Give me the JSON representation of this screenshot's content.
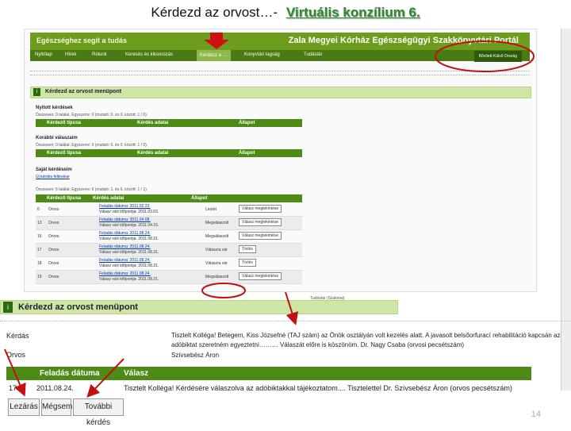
{
  "slide": {
    "title_main": "Kérdezd az orvost…-",
    "title_sub": "Virtuális konzílium 6.",
    "page_number": "14"
  },
  "portal": {
    "left_title": "Egészséghez segít a tudás",
    "right_title": "Zala Megyei Kórház Egészségügyi Szakkönyvtári Portál",
    "menu": [
      "Nyitólap",
      "Hírek",
      "Rólunk",
      "Keresés és kiksorozás",
      "Kérdezz a …",
      "Konyvtári tagság",
      "Tudástár"
    ],
    "menu_dropdown": "Bővített Külső Ország",
    "section_title": "Kérdezd az orvost menüpont",
    "open_questions": "Nyitott kérdések",
    "previous_answers": "Korábbi válaszaim",
    "own_questions": "Saját kérdéseim",
    "counter_open": "Összesen: 0 találat. Egyszerre: 0 (mutató: 0. és 0. között: 1 / 0).",
    "counter_prev": "Összesen: 0 találat. Egyszerre: 0 (mutató: 0. és 0. között: 1 / 0).",
    "counter_own": "Összesen: 6 találat. Egyszerre: 6 (mutató: 1. és 6. között: 1 / 1).",
    "new_question": "Új kérdés feltevése",
    "columns": [
      "Kérdező típusa",
      "Kérdés adatai",
      "Állapot"
    ],
    "rows": [
      {
        "id": "6",
        "type": "Orvos",
        "date": "Feladás dátuma: 2011.02.23.",
        "deadline": "Válasz várt időpontja: 2011.03.03.",
        "status": "Lezárt",
        "action": "Válasz megtekintése"
      },
      {
        "id": "13",
        "type": "Orvos",
        "date": "Feladás dátuma: 2011.04.08.",
        "deadline": "Válasz várt időpontja: 2011.04.15.",
        "status": "Megválaszolt",
        "action": "Válasz megtekintése"
      },
      {
        "id": "16",
        "type": "Orvos",
        "date": "Feladás dátuma: 2011.08.24.",
        "deadline": "Válasz várt időpontja: 2011.08.31.",
        "status": "Megválaszolt",
        "action": "Válasz megtekintése"
      },
      {
        "id": "17",
        "type": "Orvos",
        "date": "Feladás dátuma: 2011.08.24.",
        "deadline": "Válasz várt időpontja: 2011.08.31.",
        "status": "Válaszra vár",
        "action": "Törlés"
      },
      {
        "id": "18",
        "type": "Orvos",
        "date": "Feladás dátuma: 2011.08.24.",
        "deadline": "Válasz várt időpontja: 2011.08.31.",
        "status": "Válaszra vár",
        "action": "Törlés"
      },
      {
        "id": "19",
        "type": "Orvos",
        "date": "Feladás dátuma: 2011.08.24.",
        "deadline": "Válasz várt időpontja: 2011.08.31.",
        "status": "Megválaszolt",
        "action": "Válasz megtekintése"
      }
    ],
    "right_footer": "Tudástár (Szakmai)"
  },
  "detail": {
    "title": "Kérdezd az orvost menüpont",
    "label_question": "Kérdás",
    "question_text_1": "Tisztelt Kolléga! Betegem, Kiss Józsefné (TAJ szám) az Önök osztályán volt kezelés alatt. A javasolt belsőorfurací rehabilitáció kapcsán az",
    "question_text_2": "adóbiktat szeretném egyeztetni……… Válaszát előre is köszönöm. Dr. Nagy Csaba (orvosi pecsétszám)",
    "label_doctor": "Orvos",
    "doctor_name": "Szívsebész Áron",
    "col_date": "Feladás dátuma",
    "col_answer": "Válasz",
    "resp_id": "17",
    "resp_date": "2011.08.24.",
    "resp_text": "Tisztelt Kolléga! Kérdésére válaszolva az adóbiktakkal tájékoztatom.... Tisztelettel Dr. Szívsebész Áron (orvos pecsétszám)",
    "btn_close": "Lezárás",
    "btn_cancel": "Mégsem",
    "btn_more": "További kérdés"
  }
}
